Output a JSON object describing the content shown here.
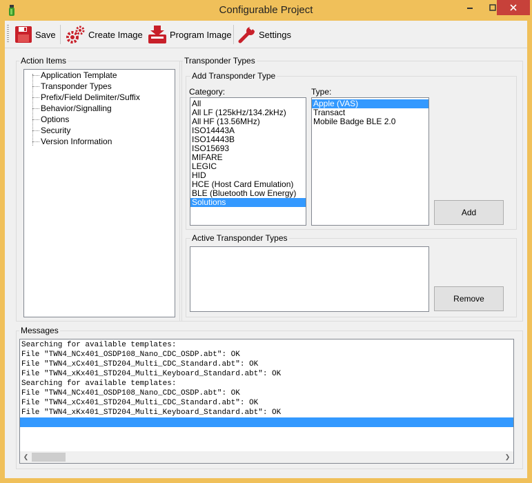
{
  "window": {
    "title": "Configurable Project"
  },
  "toolbar": {
    "save_label": "Save",
    "create_image_label": "Create Image",
    "program_image_label": "Program Image",
    "settings_label": "Settings"
  },
  "action_items": {
    "legend": "Action Items",
    "items": [
      "Application Template",
      "Transponder Types",
      "Prefix/Field Delimiter/Suffix",
      "Behavior/Signalling",
      "Options",
      "Security",
      "Version Information"
    ]
  },
  "transponder_types": {
    "legend": "Transponder Types",
    "add_group": {
      "legend": "Add Transponder Type",
      "category_label": "Category:",
      "categories": [
        "All",
        "All LF (125kHz/134.2kHz)",
        "All HF (13.56MHz)",
        "ISO14443A",
        "ISO14443B",
        "ISO15693",
        "MIFARE",
        "LEGIC",
        "HID",
        "HCE (Host Card Emulation)",
        "BLE (Bluetooth Low Energy)",
        "Solutions"
      ],
      "selected_category": "Solutions",
      "type_label": "Type:",
      "types": [
        "Apple (VAS)",
        "Transact",
        "Mobile Badge BLE 2.0"
      ],
      "selected_type": "Apple (VAS)",
      "add_label": "Add"
    },
    "active_group": {
      "legend": "Active Transponder Types",
      "items": [],
      "remove_label": "Remove"
    }
  },
  "messages": {
    "legend": "Messages",
    "lines": [
      "Searching for available templates:",
      "File \"TWN4_NCx401_OSDP108_Nano_CDC_OSDP.abt\": OK",
      "File \"TWN4_xCx401_STD204_Multi_CDC_Standard.abt\": OK",
      "File \"TWN4_xKx401_STD204_Multi_Keyboard_Standard.abt\": OK",
      "Searching for available templates:",
      "File \"TWN4_NCx401_OSDP108_Nano_CDC_OSDP.abt\": OK",
      "File \"TWN4_xCx401_STD204_Multi_CDC_Standard.abt\": OK",
      "File \"TWN4_xKx401_STD204_Multi_Keyboard_Standard.abt\": OK"
    ]
  },
  "colors": {
    "frame": "#f0c05a",
    "close_button": "#c7413a",
    "selection": "#3399ff"
  },
  "icons": [
    "app-icon",
    "minimize-icon",
    "maximize-icon",
    "close-icon",
    "save-icon",
    "create-image-icon",
    "program-image-icon",
    "settings-icon",
    "scroll-left-icon",
    "scroll-right-icon"
  ]
}
